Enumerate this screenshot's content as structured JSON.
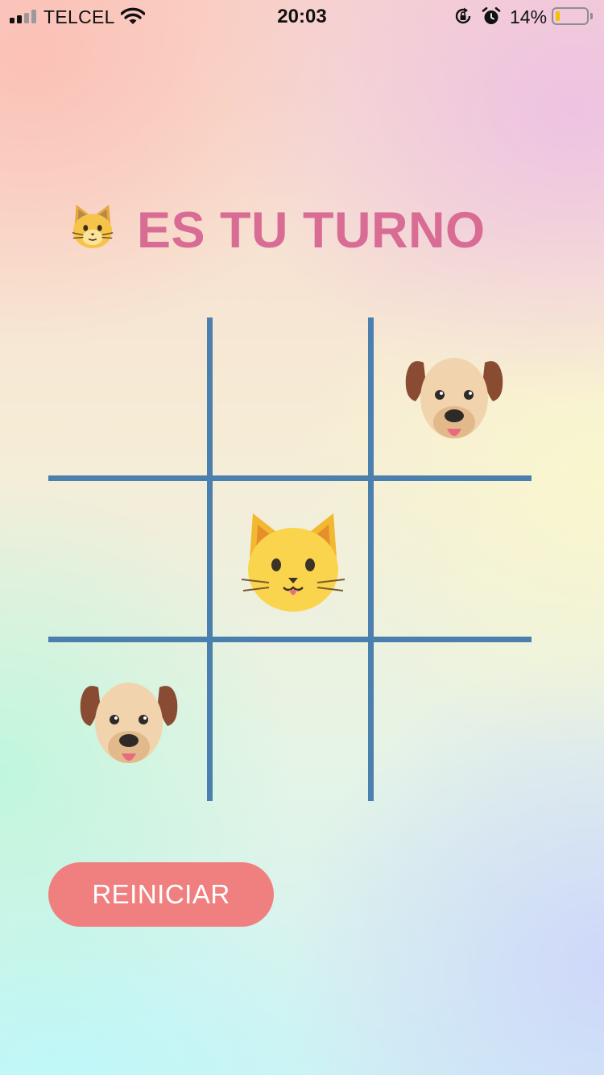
{
  "status_bar": {
    "carrier": "TELCEL",
    "time": "20:03",
    "battery_percent": "14%",
    "battery_level": 0.14,
    "signal_bars": 2,
    "icons": [
      "signal-icon",
      "wifi-icon",
      "rotation-lock-icon",
      "alarm-icon",
      "battery-icon"
    ]
  },
  "turn": {
    "player_icon": "cat-face-icon",
    "text": "ES TU TURNO"
  },
  "board": {
    "cells": [
      "",
      "",
      "dog",
      "",
      "cat",
      "",
      "dog",
      "",
      ""
    ],
    "line_color": "#4a7fae"
  },
  "reset_button": {
    "label": "REINICIAR",
    "color": "#f08080"
  },
  "colors": {
    "title": "#d86c94"
  }
}
